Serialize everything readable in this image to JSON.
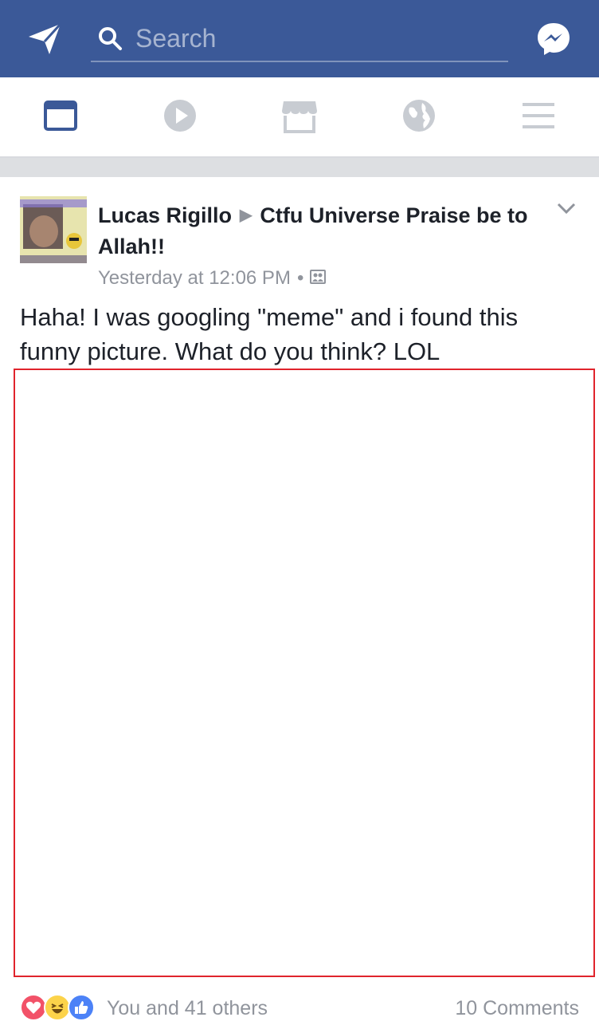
{
  "header": {
    "search_placeholder": "Search",
    "brand_color": "#3b5998"
  },
  "tabs": [
    {
      "icon": "news-feed-icon",
      "active": true
    },
    {
      "icon": "video-play-icon",
      "active": false
    },
    {
      "icon": "marketplace-icon",
      "active": false
    },
    {
      "icon": "globe-notifications-icon",
      "active": false
    },
    {
      "icon": "menu-icon",
      "active": false
    }
  ],
  "post": {
    "author": "Lucas Rigillo",
    "arrow": "▶",
    "group": "Ctfu Universe Praise be to Allah!!",
    "timestamp": "Yesterday at 12:06 PM",
    "separator": "•",
    "text": "Haha! I was googling \"meme\" and i found this funny picture. What do you think? LOL",
    "reactions_summary": "You and 41 others",
    "comments_count": "10 Comments",
    "image_border_color": "#e0242c"
  }
}
